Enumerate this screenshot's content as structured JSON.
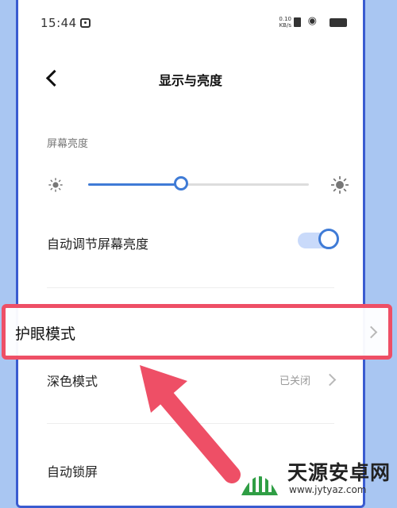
{
  "status_bar": {
    "time": "15:44",
    "net_speed_line1": "0.10",
    "net_speed_line2": "KB/s",
    "wifi_glyph": "◉"
  },
  "header": {
    "title": "显示与亮度"
  },
  "brightness": {
    "section_label": "屏幕亮度",
    "level_percent": 42
  },
  "settings": {
    "auto_brightness_label": "自动调节屏幕亮度",
    "auto_brightness_enabled": true,
    "eye_care_label": "护眼模式",
    "dark_mode_label": "深色模式",
    "dark_mode_value": "已关闭",
    "auto_lock_label": "自动锁屏"
  },
  "watermark": {
    "name": "天源安卓网",
    "url": "www.jytyaz.com"
  },
  "colors": {
    "accent": "#3f7bd6",
    "highlight": "#ee4f66",
    "background": "#a9c6f2"
  }
}
